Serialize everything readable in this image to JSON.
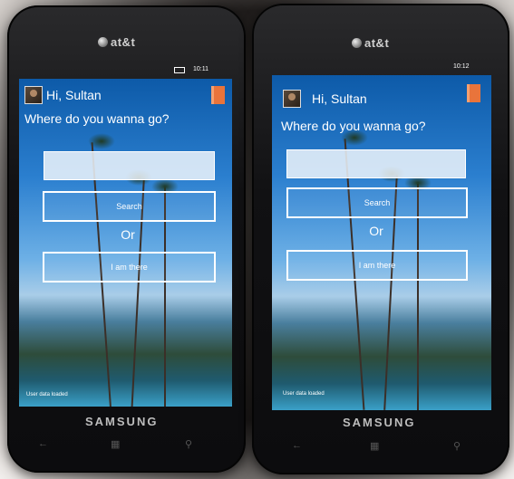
{
  "phones": [
    {
      "carrier": "at&t",
      "maker": "SAMSUNG",
      "time": "10:11",
      "greeting": "Hi, Sultan",
      "prompt": "Where do you wanna go?",
      "search_value": "",
      "search_label": "Search",
      "or_label": "Or",
      "iamthere_label": "I am there",
      "status_text": "User data loaded"
    },
    {
      "carrier": "at&t",
      "maker": "SAMSUNG",
      "time": "10:12",
      "greeting": "Hi, Sultan",
      "prompt": "Where do you wanna go?",
      "search_value": "",
      "search_label": "Search",
      "or_label": "Or",
      "iamthere_label": "I am there",
      "status_text": "User data loaded"
    }
  ],
  "icons": {
    "profile": "avatar-photo",
    "logout": "door-exit-icon",
    "nav_back": "back-arrow-icon",
    "nav_start": "windows-logo-icon",
    "nav_search": "search-icon"
  },
  "colors": {
    "app_text": "#ffffff",
    "logout_icon": "#e9743b"
  }
}
